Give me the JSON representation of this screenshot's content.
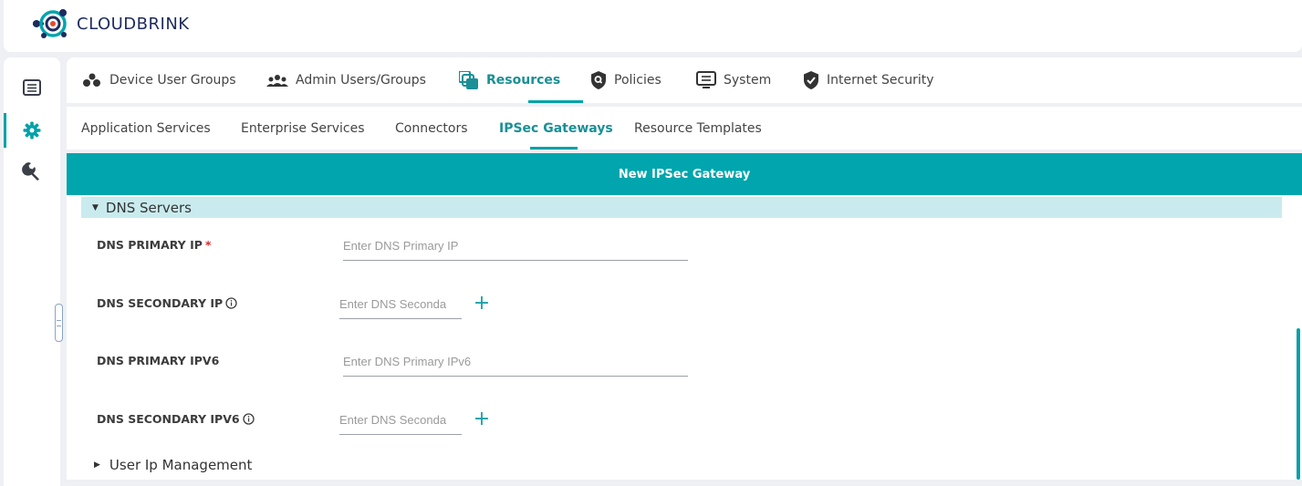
{
  "brand": {
    "name": "CLOUDBRINK",
    "accent": "#00a5ad"
  },
  "left_rail": {
    "items": [
      {
        "icon": "list-icon",
        "active": false
      },
      {
        "icon": "gear-icon",
        "active": true
      },
      {
        "icon": "wrench-icon",
        "active": false
      }
    ]
  },
  "main_nav": {
    "items": [
      {
        "label": "Device User Groups",
        "icon": "device-users-icon"
      },
      {
        "label": "Admin Users/Groups",
        "icon": "admin-users-icon"
      },
      {
        "label": "Resources",
        "icon": "resources-icon",
        "active": true
      },
      {
        "label": "Policies",
        "icon": "shield-search-icon"
      },
      {
        "label": "System",
        "icon": "monitor-icon"
      },
      {
        "label": "Internet Security",
        "icon": "shield-check-icon"
      }
    ]
  },
  "sub_nav": {
    "items": [
      {
        "label": "Application Services"
      },
      {
        "label": "Enterprise Services"
      },
      {
        "label": "Connectors"
      },
      {
        "label": "IPSec Gateways",
        "active": true
      },
      {
        "label": "Resource Templates"
      }
    ]
  },
  "panel": {
    "title": "New IPSec Gateway",
    "dns_section": {
      "title": "DNS Servers",
      "fields": [
        {
          "label": "DNS PRIMARY IP",
          "required": "*",
          "placeholder": "Enter DNS Primary IP"
        },
        {
          "label": "DNS SECONDARY IP",
          "placeholder": "Enter DNS Seconda"
        },
        {
          "label": "DNS PRIMARY IPV6",
          "placeholder": "Enter DNS Primary IPv6"
        },
        {
          "label": "DNS SECONDARY IPV6",
          "placeholder": "Enter DNS Seconda"
        }
      ],
      "add_symbol": "+"
    },
    "collapsed_section": {
      "title": "User Ip Management"
    }
  }
}
